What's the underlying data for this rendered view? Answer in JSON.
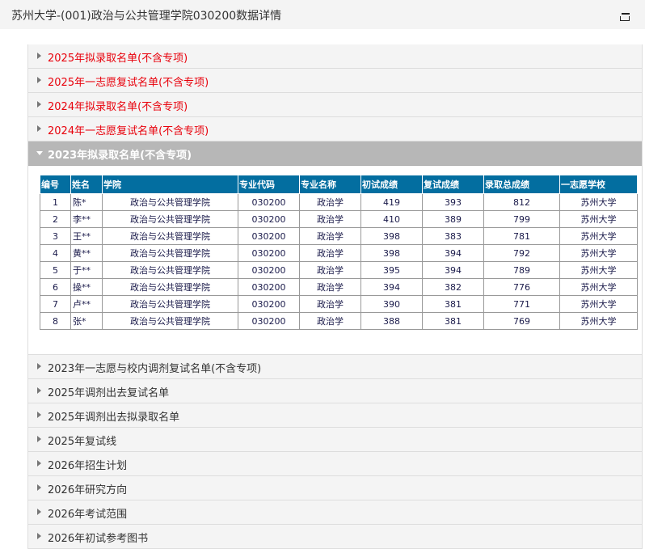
{
  "header": {
    "title": "苏州大学-(001)政治与公共管理学院030200数据详情"
  },
  "accordion_top": [
    {
      "label": "2025年拟录取名单(不含专项)"
    },
    {
      "label": "2025年一志愿复试名单(不含专项)"
    },
    {
      "label": "2024年拟录取名单(不含专项)"
    },
    {
      "label": "2024年一志愿复试名单(不含专项)"
    }
  ],
  "active_section": {
    "label": "2023年拟录取名单(不含专项)",
    "table": {
      "headers": [
        "编号",
        "姓名",
        "学院",
        "专业代码",
        "专业名称",
        "初试成绩",
        "复试成绩",
        "录取总成绩",
        "一志愿学校"
      ],
      "rows": [
        [
          "1",
          "陈*",
          "政治与公共管理学院",
          "030200",
          "政治学",
          "419",
          "393",
          "812",
          "苏州大学"
        ],
        [
          "2",
          "李**",
          "政治与公共管理学院",
          "030200",
          "政治学",
          "410",
          "389",
          "799",
          "苏州大学"
        ],
        [
          "3",
          "王**",
          "政治与公共管理学院",
          "030200",
          "政治学",
          "398",
          "383",
          "781",
          "苏州大学"
        ],
        [
          "4",
          "黄**",
          "政治与公共管理学院",
          "030200",
          "政治学",
          "398",
          "394",
          "792",
          "苏州大学"
        ],
        [
          "5",
          "于**",
          "政治与公共管理学院",
          "030200",
          "政治学",
          "395",
          "394",
          "789",
          "苏州大学"
        ],
        [
          "6",
          "操**",
          "政治与公共管理学院",
          "030200",
          "政治学",
          "394",
          "382",
          "776",
          "苏州大学"
        ],
        [
          "7",
          "卢**",
          "政治与公共管理学院",
          "030200",
          "政治学",
          "390",
          "381",
          "771",
          "苏州大学"
        ],
        [
          "8",
          "张*",
          "政治与公共管理学院",
          "030200",
          "政治学",
          "388",
          "381",
          "769",
          "苏州大学"
        ]
      ]
    }
  },
  "accordion_bottom": [
    {
      "label": "2023年一志愿与校内调剂复试名单(不含专项)"
    },
    {
      "label": "2025年调剂出去复试名单"
    },
    {
      "label": "2025年调剂出去拟录取名单"
    },
    {
      "label": "2025年复试线"
    },
    {
      "label": "2026年招生计划"
    },
    {
      "label": "2026年研究方向"
    },
    {
      "label": "2026年考试范围"
    },
    {
      "label": "2026年初试参考图书"
    }
  ],
  "colors": {
    "highlight_text": "#e8000b",
    "table_header_bg": "#036ea0",
    "active_header_bg": "#b7b7b7"
  },
  "icons": {
    "collapse": "window-collapse-icon",
    "section_closed": "triangle-right-icon",
    "section_open": "triangle-down-icon"
  }
}
